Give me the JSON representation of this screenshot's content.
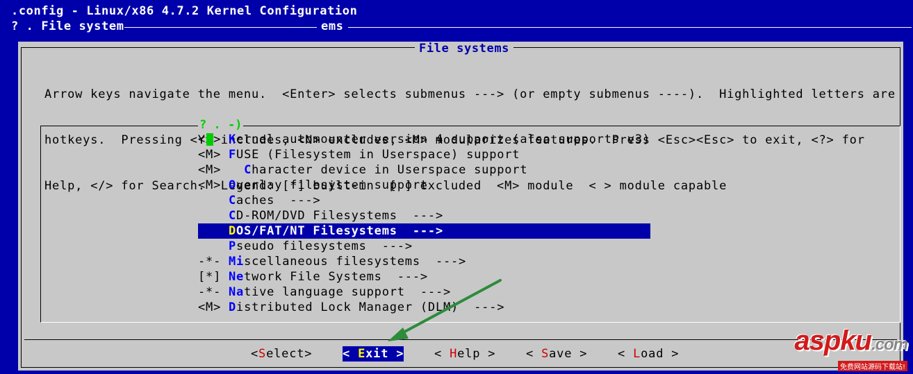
{
  "window": {
    "title": ".config - Linux/x86 4.7.2 Kernel Configuration",
    "breadcrumb": "? . File system",
    "breadcrumb_tail": "ems"
  },
  "dialog": {
    "title": "File systems",
    "help_lines": [
      "Arrow keys navigate the menu.  <Enter> selects submenus ---> (or empty submenus ----).  Highlighted letters are",
      "hotkeys.  Pressing <Y> includes, <N> excludes, <M> modularizes features.  Press <Esc><Esc> to exit, <?> for",
      "Help, </> for Search.  Legend: [*] built-in  [ ] excluded  <M> module  < > module capable"
    ],
    "menu_top_label": "? . -)"
  },
  "menu": {
    "items": [
      {
        "prefix": "<*>",
        "hot": "K",
        "rest": "ernel automounter version 4 support (also supports v3)",
        "indent": ""
      },
      {
        "prefix": "<M>",
        "hot": "F",
        "rest": "USE (Filesystem in Userspace) support",
        "indent": ""
      },
      {
        "prefix": "<M>",
        "hot": "C",
        "rest": "haracter device in Userspace support",
        "indent": "  "
      },
      {
        "prefix": "<M>",
        "hot": "O",
        "rest": "verlay filesystem support",
        "indent": ""
      },
      {
        "prefix": "",
        "hot": "C",
        "rest": "aches  --->",
        "indent": ""
      },
      {
        "prefix": "",
        "hot": "C",
        "rest": "D-ROM/DVD Filesystems  --->",
        "indent": ""
      },
      {
        "prefix": "",
        "hot": "D",
        "rest": "OS/FAT/NT Filesystems  --->",
        "indent": ""
      },
      {
        "prefix": "",
        "hot": "P",
        "rest": "seudo filesystems  --->",
        "indent": ""
      },
      {
        "prefix": "-*-",
        "hot": "Mi",
        "rest": "scellaneous filesystems  --->",
        "indent": ""
      },
      {
        "prefix": "[*]",
        "hot": "Ne",
        "rest": "twork File Systems  --->",
        "indent": ""
      },
      {
        "prefix": "-*-",
        "hot": "Na",
        "rest": "tive language support  --->",
        "indent": ""
      },
      {
        "prefix": "<M>",
        "hot": "D",
        "rest": "istributed Lock Manager (DLM)  --->",
        "indent": ""
      }
    ],
    "selected_index": 6
  },
  "buttons": {
    "select": {
      "open": "<",
      "hot": "S",
      "rest": "elect",
      "close": ">"
    },
    "exit": {
      "open": "< ",
      "hot": "E",
      "rest": "xit",
      "close": " >"
    },
    "help": {
      "open": "< ",
      "hot": "H",
      "rest": "elp",
      "close": " >"
    },
    "save": {
      "open": "< ",
      "hot": "S",
      "rest": "ave",
      "close": " >"
    },
    "load": {
      "open": "< ",
      "hot": "L",
      "rest": "oad",
      "close": " >"
    }
  },
  "watermark": {
    "brand_main": "aspku",
    "brand_suffix": ".com",
    "tagline": "免费网站源码下载站!"
  },
  "colors": {
    "background": "#0000aa",
    "dialog": "#c8c8c8",
    "hotkey": "#0000ff",
    "button_hotkey": "#cc0000",
    "selected_hotkey": "#ffff00",
    "arrow": "#2e8b3c",
    "watermark": "#d21a1a"
  }
}
